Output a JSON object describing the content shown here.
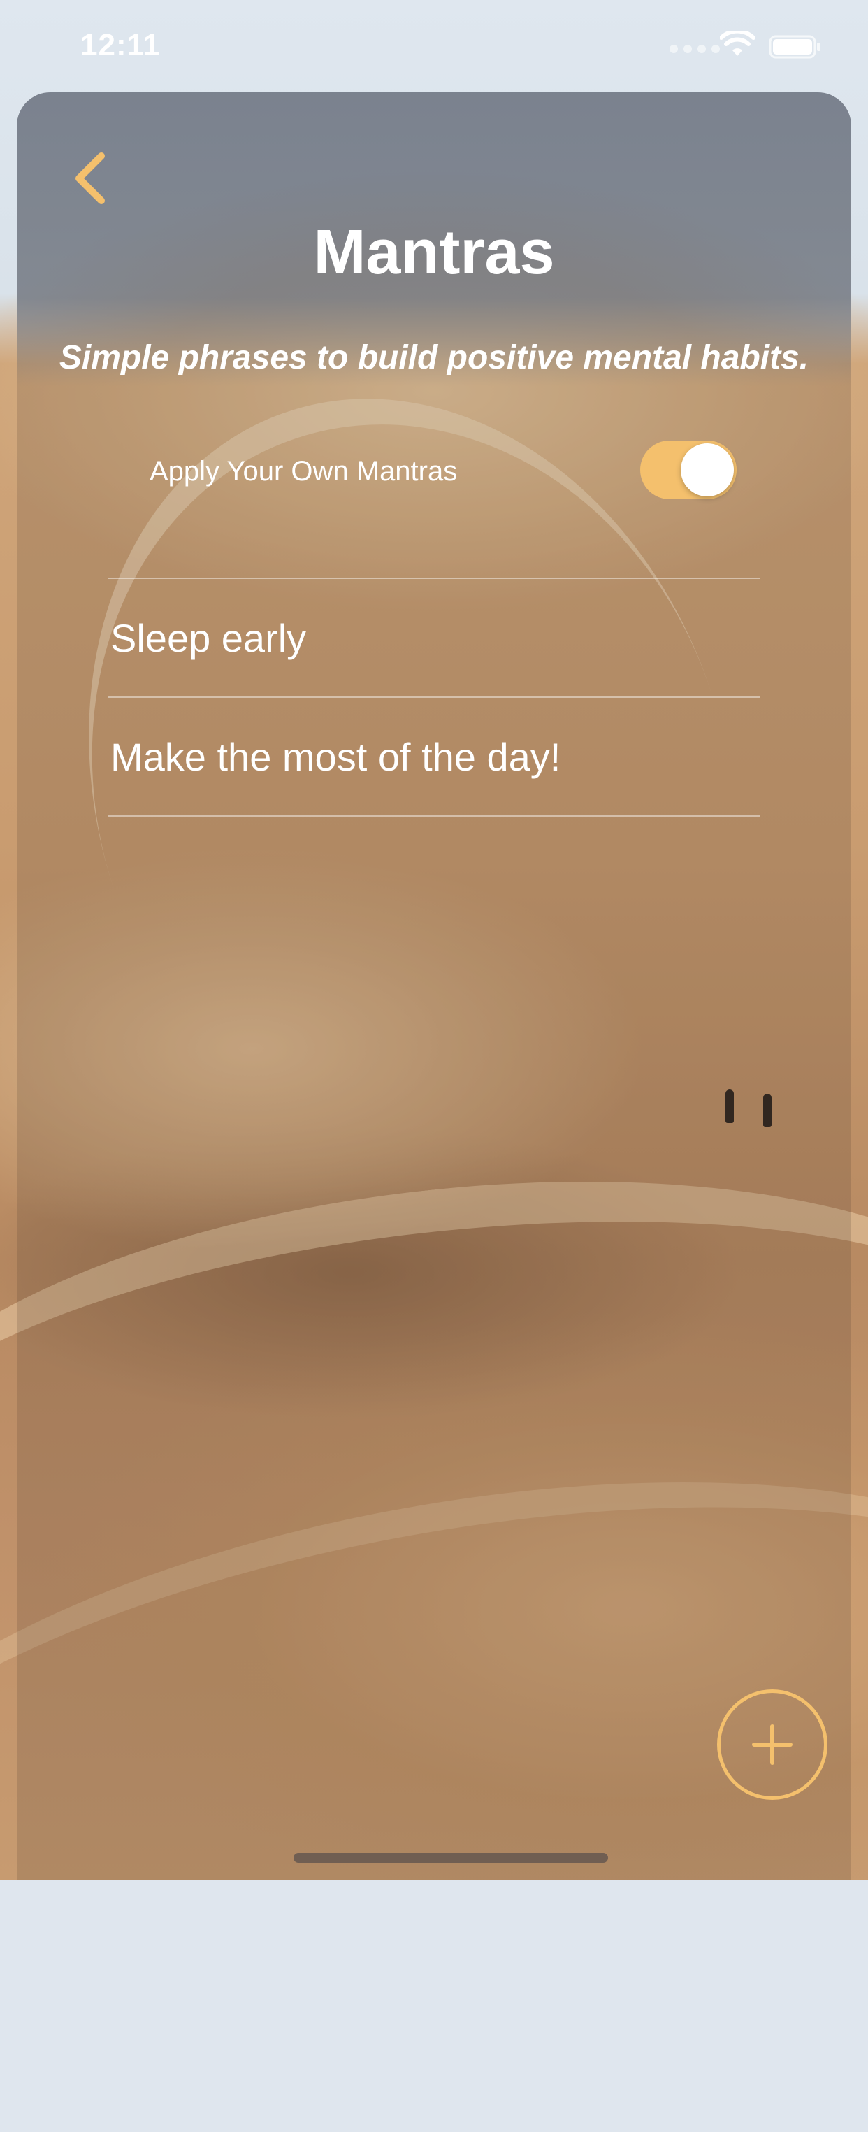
{
  "status_bar": {
    "time": "12:11"
  },
  "header": {
    "back_icon": "chevron-left-icon",
    "title": "Mantras",
    "subtitle": "Simple phrases to build positive mental habits."
  },
  "settings": {
    "apply_own_label": "Apply Your Own Mantras",
    "apply_own_enabled": true
  },
  "mantras": [
    {
      "text": "Sleep early"
    },
    {
      "text": "Make the most of the day!"
    }
  ],
  "actions": {
    "add_icon": "plus-icon"
  },
  "colors": {
    "accent": "#f4c06d",
    "text": "#ffffff"
  }
}
